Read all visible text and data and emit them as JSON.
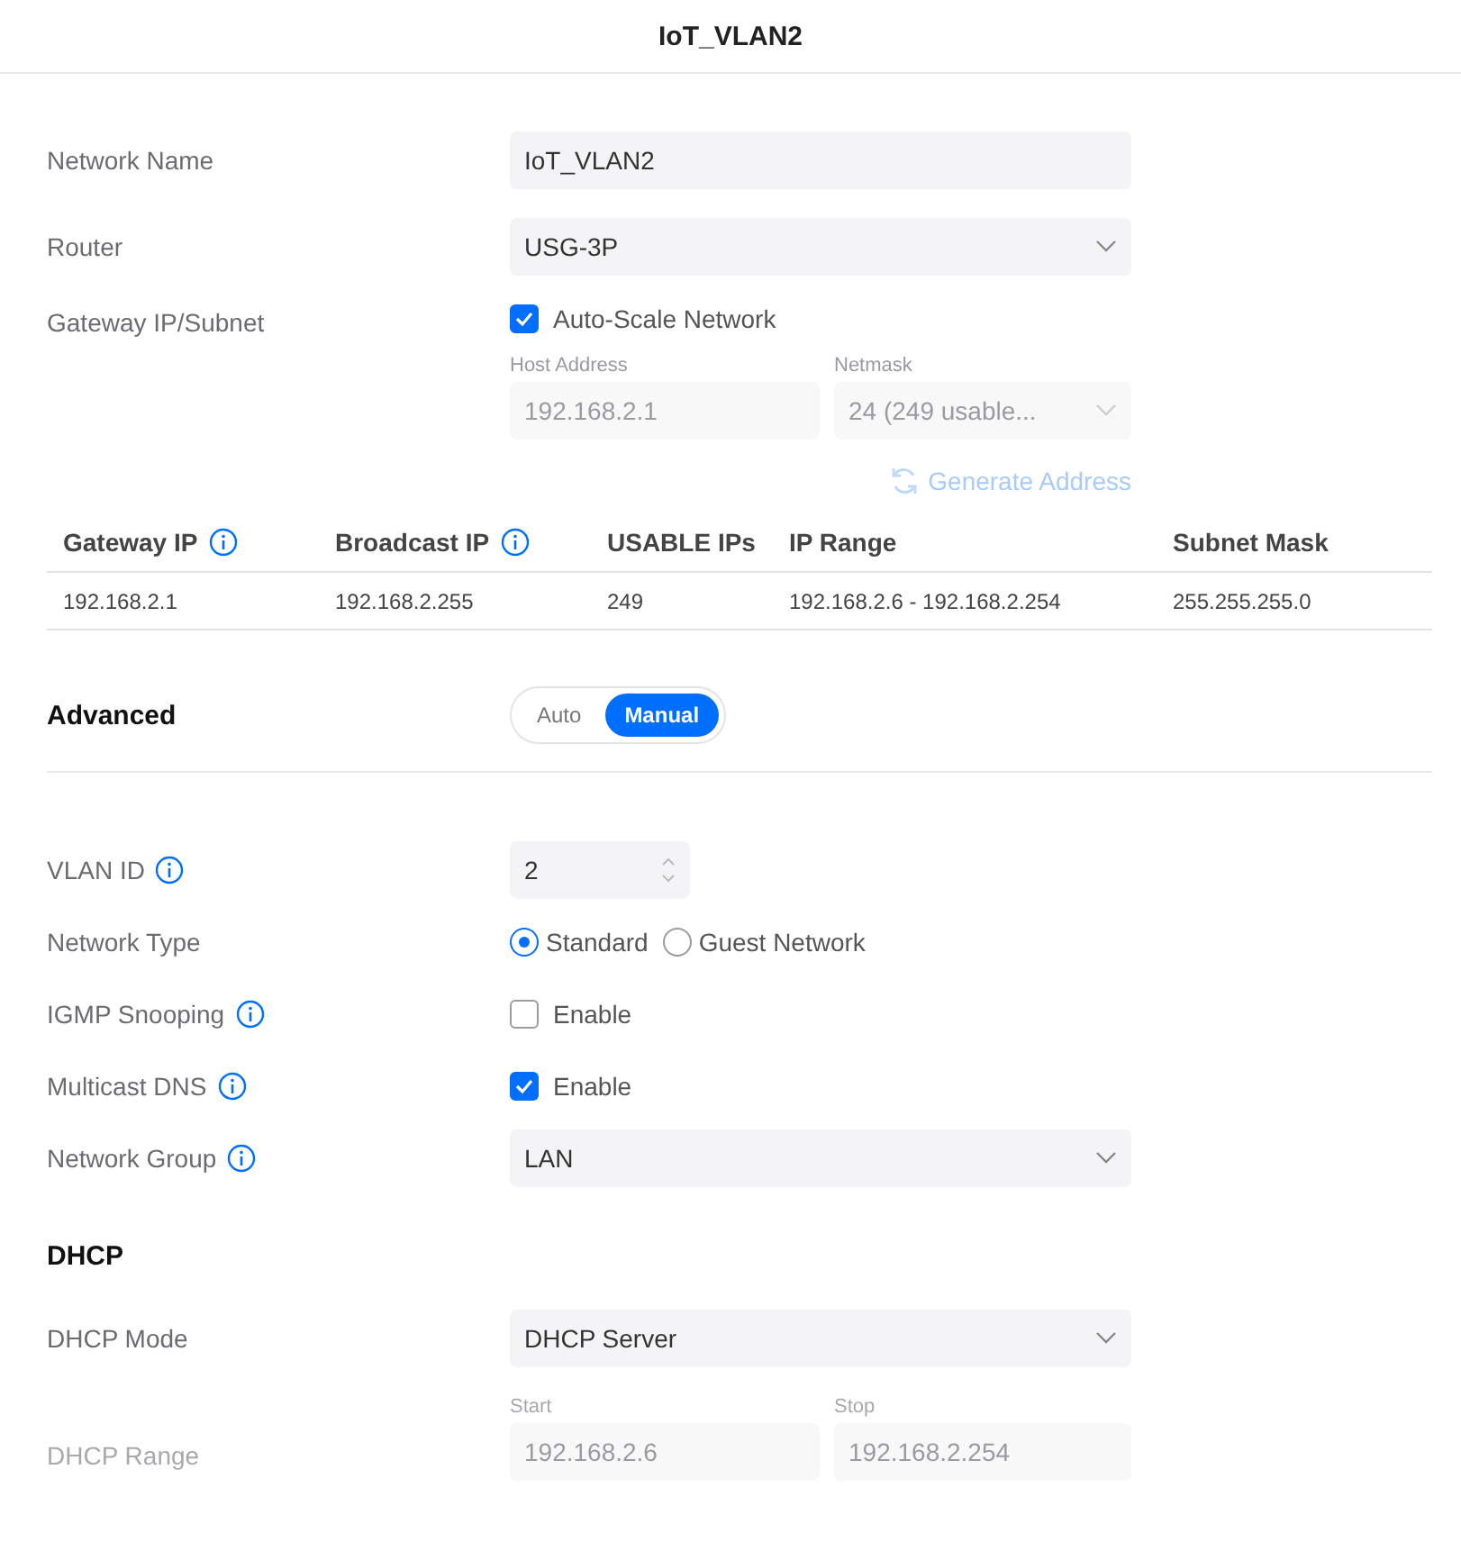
{
  "title": "IoT_VLAN2",
  "general": [
    {
      "kind": "text",
      "label": "Network Name",
      "value": "IoT_VLAN2"
    },
    {
      "kind": "select",
      "label": "Router",
      "value": "USG-3P"
    }
  ],
  "gateway": {
    "label": "Gateway IP/Subnet",
    "auto_scale": {
      "label": "Auto-Scale Network",
      "checked": true
    },
    "host_address": {
      "label": "Host Address",
      "value": "192.168.2.1",
      "disabled": true
    },
    "netmask": {
      "label": "Netmask",
      "value": "24 (249 usable...",
      "disabled": true
    },
    "generate": {
      "label": "Generate Address",
      "disabled": true
    }
  },
  "table": {
    "columns": [
      {
        "label": "Gateway IP",
        "info": true
      },
      {
        "label": "Broadcast IP",
        "info": true
      },
      {
        "label": "USABLE IPs",
        "info": false
      },
      {
        "label": "IP Range",
        "info": false
      },
      {
        "label": "Subnet Mask",
        "info": false
      }
    ],
    "rows": [
      [
        "192.168.2.1",
        "192.168.2.255",
        "249",
        "192.168.2.6 - 192.168.2.254",
        "255.255.255.0"
      ]
    ]
  },
  "advanced": {
    "title": "Advanced",
    "modes": [
      {
        "label": "Auto",
        "selected": false
      },
      {
        "label": "Manual",
        "selected": true
      }
    ],
    "rows": [
      {
        "kind": "number",
        "label": "VLAN ID",
        "info": true,
        "value": "2"
      },
      {
        "kind": "radio",
        "label": "Network Type",
        "info": false,
        "options": [
          {
            "label": "Standard",
            "selected": true
          },
          {
            "label": "Guest Network",
            "selected": false
          }
        ]
      },
      {
        "kind": "checkbox",
        "label": "IGMP Snooping",
        "info": true,
        "option": {
          "label": "Enable",
          "checked": false
        }
      },
      {
        "kind": "checkbox",
        "label": "Multicast DNS",
        "info": true,
        "option": {
          "label": "Enable",
          "checked": true
        }
      },
      {
        "kind": "select",
        "label": "Network Group",
        "info": true,
        "value": "LAN"
      }
    ]
  },
  "dhcp": {
    "title": "DHCP",
    "mode": {
      "label": "DHCP Mode",
      "value": "DHCP Server"
    },
    "range": {
      "label": "DHCP Range",
      "start": {
        "label": "Start",
        "value": "192.168.2.6"
      },
      "stop": {
        "label": "Stop",
        "value": "192.168.2.254"
      }
    }
  }
}
